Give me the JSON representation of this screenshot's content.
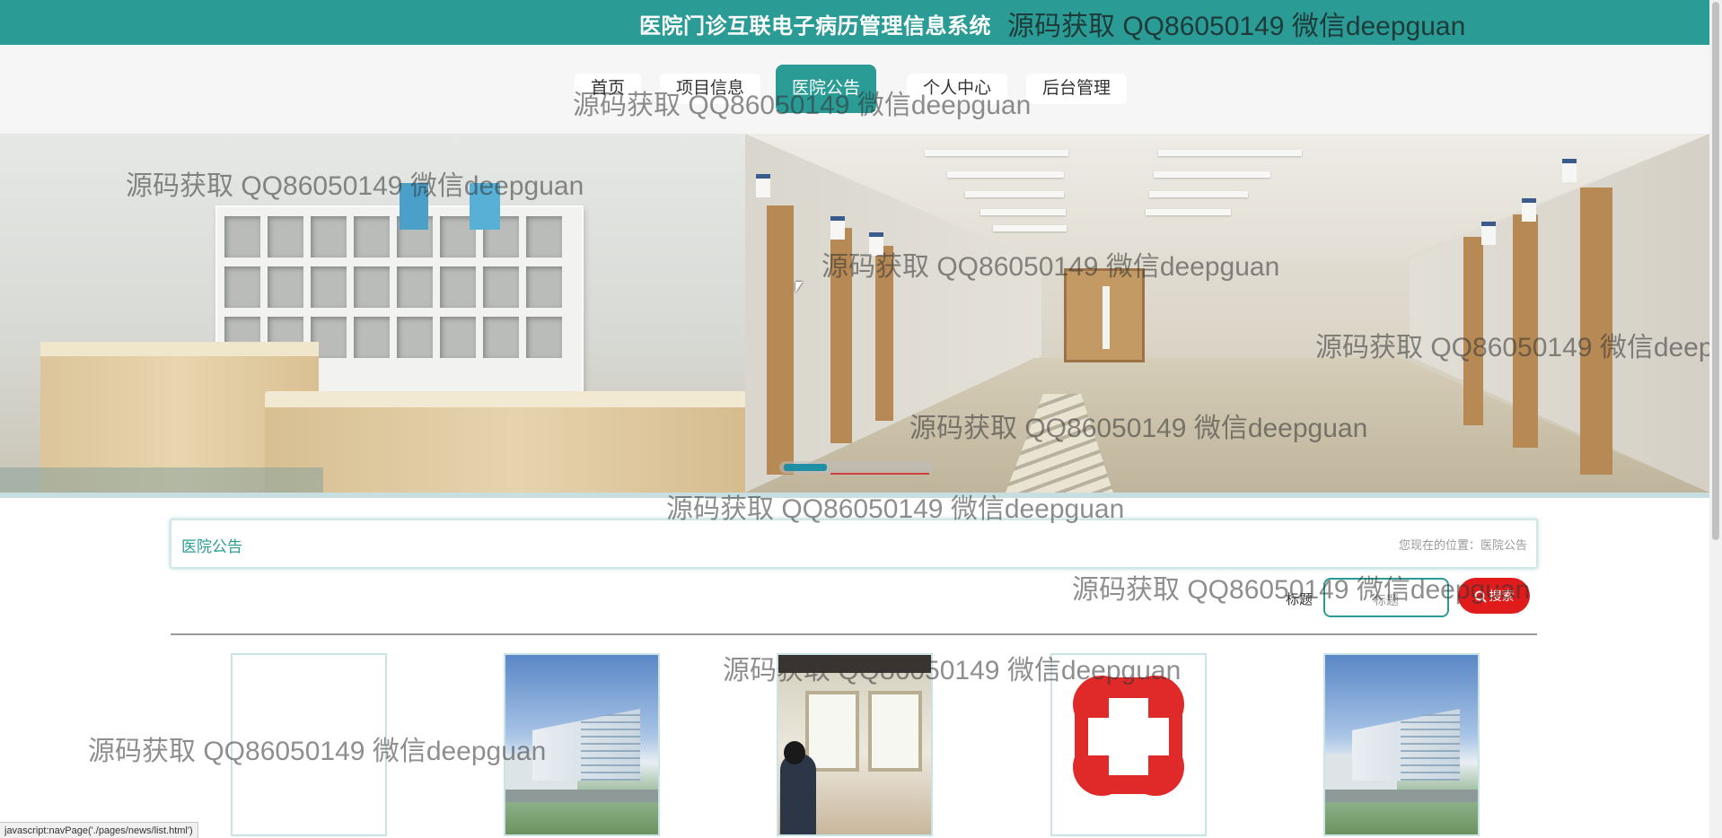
{
  "header": {
    "site_title": "医院门诊互联电子病历管理信息系统",
    "title_watermark": "源码获取 QQ86050149 微信deepguan"
  },
  "nav": {
    "items": [
      {
        "label": "首页",
        "active": false
      },
      {
        "label": "项目信息",
        "active": false
      },
      {
        "label": "医院公告",
        "active": true
      },
      {
        "label": "个人中心",
        "active": false
      },
      {
        "label": "后台管理",
        "active": false
      }
    ]
  },
  "banner": {
    "active_slide": 1,
    "slide_count": 3
  },
  "breadcrumb": {
    "title": "医院公告",
    "location_prefix": "您现在的位置：",
    "location": "医院公告",
    "location_full": "您现在的位置：医院公告"
  },
  "search": {
    "label": "标题",
    "placeholder": "标题",
    "button_label": "搜索",
    "button_icon": "search-icon"
  },
  "cards": [
    {
      "image": "blank"
    },
    {
      "image": "hospital-building"
    },
    {
      "image": "clinic-interior"
    },
    {
      "image": "red-cross"
    },
    {
      "image": "hospital-building"
    }
  ],
  "status_bar": {
    "text": "javascript:navPage('./pages/news/list.html')"
  },
  "watermarks": [
    "源码获取 QQ86050149 微信deepguan"
  ],
  "colors": {
    "primary": "#2b9b95",
    "search_button": "#e01b1b",
    "nav_background": "#f6f6f6"
  }
}
